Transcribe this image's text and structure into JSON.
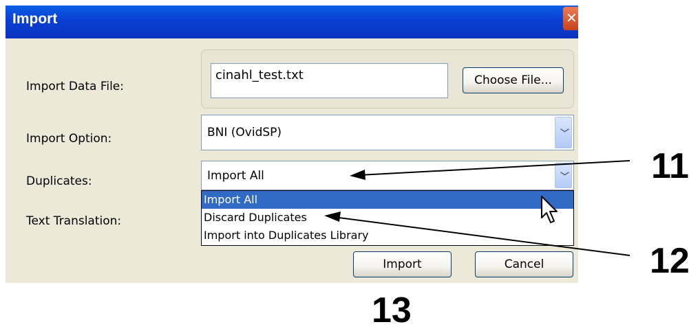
{
  "window": {
    "title": "Import"
  },
  "form": {
    "import_data_file_label": "Import Data File:",
    "import_data_file_value": "cinahl_test.txt",
    "choose_file_label": "Choose File...",
    "import_option_label": "Import Option:",
    "import_option_value": "BNI (OvidSP)",
    "duplicates_label": "Duplicates:",
    "duplicates_value": "Import All",
    "text_translation_label": "Text Translation:"
  },
  "duplicates_dropdown": {
    "options": [
      "Import All",
      "Discard Duplicates",
      "Import into Duplicates Library"
    ],
    "highlighted": "Import All"
  },
  "buttons": {
    "import_label": "Import",
    "cancel_label": "Cancel"
  },
  "callouts": {
    "duplicates_combo": "11",
    "duplicates_options": "12",
    "import_button": "13"
  },
  "colors": {
    "titlebar": "#0a3fd2",
    "dialog_bg": "#ece9d8",
    "selection": "#316ac5"
  }
}
